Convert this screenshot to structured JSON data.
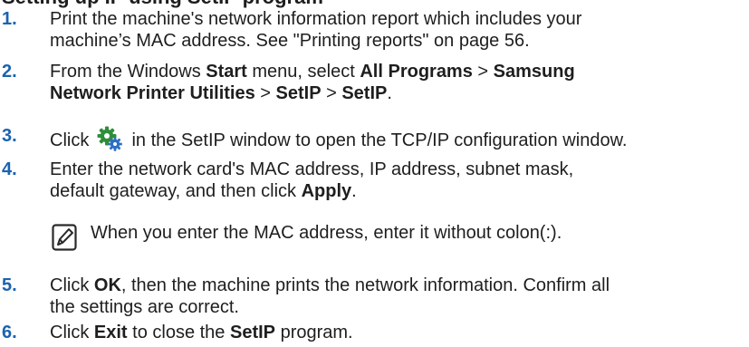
{
  "heading": "Setting up IP using SetIP program",
  "steps": [
    {
      "num": "1.",
      "line1": "Print the machine's network information report which includes your",
      "line2": "machine’s MAC address. See \"Printing reports\" on page 56."
    },
    {
      "num": "2.",
      "l1_a": "From the Windows ",
      "l1_b": "Start",
      "l1_c": " menu, select ",
      "l1_d": "All Programs",
      "l1_e": " > ",
      "l1_f": "Samsung",
      "l2_a": "Network Printer Utilities",
      "l2_b": " > ",
      "l2_c": "SetIP",
      "l2_d": " > ",
      "l2_e": "SetIP",
      "l2_f": "."
    },
    {
      "num": "3.",
      "before_icon": "Click ",
      "icon": "settings-gear-icon",
      "after_icon": " in the SetIP window to open the TCP/IP configuration window."
    },
    {
      "num": "4.",
      "line1": "Enter the network card's MAC address, IP address, subnet mask,",
      "line2_a": "default gateway, and then click ",
      "line2_b": "Apply",
      "line2_c": "."
    },
    {
      "num": "5.",
      "l1_a": "Click ",
      "l1_b": "OK",
      "l1_c": ", then the machine prints the network information. Confirm all",
      "line2": "the settings are correct."
    },
    {
      "num": "6.",
      "a": "Click ",
      "b": "Exit",
      "c": " to close the ",
      "d": "SetIP",
      "e": " program."
    }
  ],
  "note": {
    "icon": "note-pencil-icon",
    "text": "When you enter the MAC address, enter it without colon(:)."
  },
  "colors": {
    "text": "#1e1e1e",
    "step_number": "#1a63b0",
    "gear_green": "#2e8f3a",
    "gear_blue": "#2d6fc4"
  }
}
